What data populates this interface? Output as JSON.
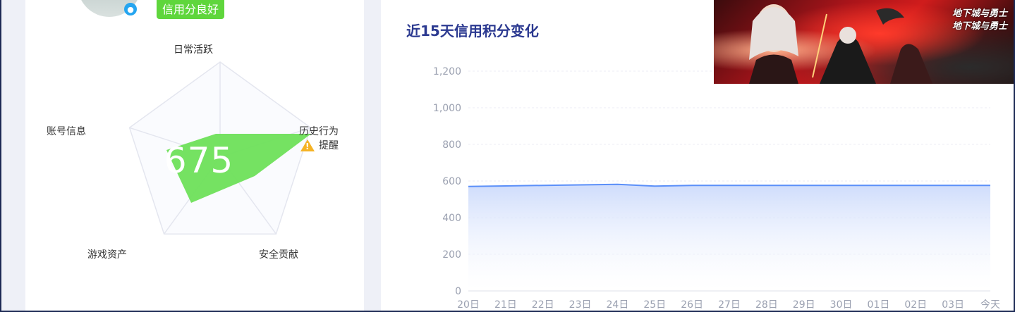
{
  "profile": {
    "credit_status": "信用分良好",
    "score": "675"
  },
  "radar": {
    "axes": [
      {
        "label": "日常活跃"
      },
      {
        "label": "历史行为"
      },
      {
        "label": "安全贡献"
      },
      {
        "label": "游戏资产"
      },
      {
        "label": "账号信息"
      }
    ],
    "warning_text": "提醒",
    "colors": {
      "fill": "#6ee05a",
      "grid": "#e4e6ef"
    }
  },
  "chart_panel": {
    "title": "近15天信用积分变化"
  },
  "chart_data": {
    "type": "area",
    "categories": [
      "20日",
      "21日",
      "22日",
      "23日",
      "24日",
      "25日",
      "26日",
      "27日",
      "28日",
      "29日",
      "30日",
      "01日",
      "02日",
      "03日",
      "今天"
    ],
    "series": [
      {
        "values": [
          570,
          573,
          576,
          579,
          582,
          572,
          576,
          576,
          576,
          576,
          576,
          576,
          576,
          576,
          576
        ]
      }
    ],
    "ylim": [
      0,
      1200
    ],
    "yticks": [
      "0",
      "200",
      "400",
      "600",
      "800",
      "1,000",
      "1,200"
    ],
    "grid": true,
    "colors": {
      "line": "#5b8ff9",
      "area_top": "#c9d8fb"
    }
  },
  "ad": {
    "logo_text": "地下城与勇士"
  }
}
